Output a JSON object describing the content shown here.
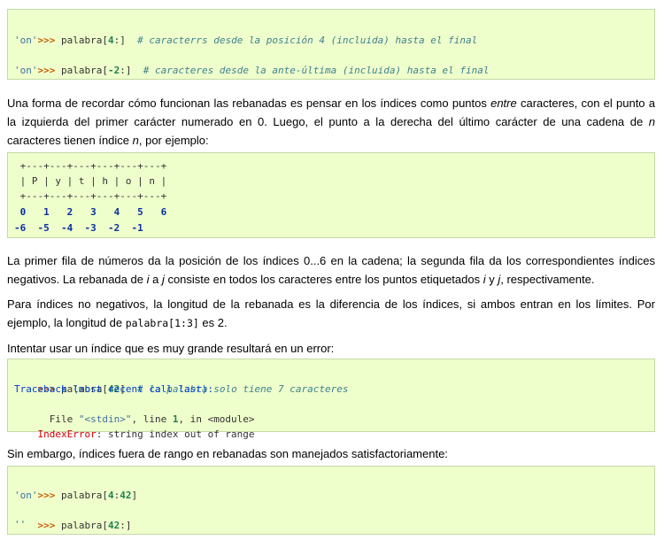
{
  "block1": {
    "lines": [
      {
        "prompt": ">>>",
        "code": " palabra[",
        "num": "4",
        "code2": ":]  ",
        "comment": "# caracterrs desde la posición 4 (incluida) hasta el final"
      },
      {
        "output": "'on'"
      },
      {
        "prompt": ">>>",
        "code": " palabra[",
        "num": "-2",
        "code2": ":]  ",
        "comment": "# caracteres desde la ante-última (incluida) hasta el final"
      },
      {
        "output": "'on'"
      }
    ]
  },
  "para1": {
    "t1": "Una forma de recordar cómo funcionan las rebanadas es pensar en los índices como puntos ",
    "em1": "entre",
    "t2": " caracteres, con el punto a la izquierda del primer carácter numerado en 0. Luego, el punto a la derecha del último carácter de una cadena de ",
    "em2": "n",
    "t3": " caracteres tienen índice ",
    "em3": "n",
    "t4": ", por ejemplo:"
  },
  "diagram": {
    "border1": " +---+---+---+---+---+---+",
    "letters": " | P | y | t | h | o | n |",
    "border2": " +---+---+---+---+---+---+",
    "positive": " 0   1   2   3   4   5   6",
    "negative": "-6  -5  -4  -3  -2  -1"
  },
  "para2": {
    "t1": "La primer fila de números da la posición de los índices 0...6 en la cadena; la segunda fila da los correspondientes índices negativos. La rebanada de ",
    "em1": "i",
    "t2": " a ",
    "em2": "j",
    "t3": " consiste en todos los caracteres entre los puntos etiquetados ",
    "em3": "i",
    "t4": " y ",
    "em4": "j",
    "t5": ", respectivamente."
  },
  "para3": {
    "t1": "Para índices no negativos, la longitud de la rebanada es la diferencia de los índices, si ambos entran en los límites. Por ejemplo, la longitud de ",
    "code": "palabra[1:3]",
    "t2": " es 2."
  },
  "para4": "Intentar usar un índice que es muy grande resultará en un error:",
  "block2": {
    "prompt": ">>>",
    "code": " palabra[",
    "num": "42",
    "code2": "]  ",
    "comment": "# la palabra solo tiene 7 caracteres",
    "traceback": "Traceback (most recent call last):",
    "file_pre": "  File ",
    "file_str": "\"<stdin>\"",
    "file_mid": ", line ",
    "file_num": "1",
    "file_post": ", in <module>",
    "exc_name": "IndexError",
    "exc_msg": ": string index out of range"
  },
  "para5": "Sin embargo, índices fuera de rango en rebanadas son manejados satisfactoriamente:",
  "block3": {
    "l1_prompt": ">>>",
    "l1_code": " palabra[",
    "l1_num": "4",
    "l1_colon": ":",
    "l1_num2": "42",
    "l1_end": "]",
    "l2": "'on'",
    "l3_prompt": ">>>",
    "l3_code": " palabra[",
    "l3_num": "42",
    "l3_end": ":]",
    "l4": "''"
  }
}
